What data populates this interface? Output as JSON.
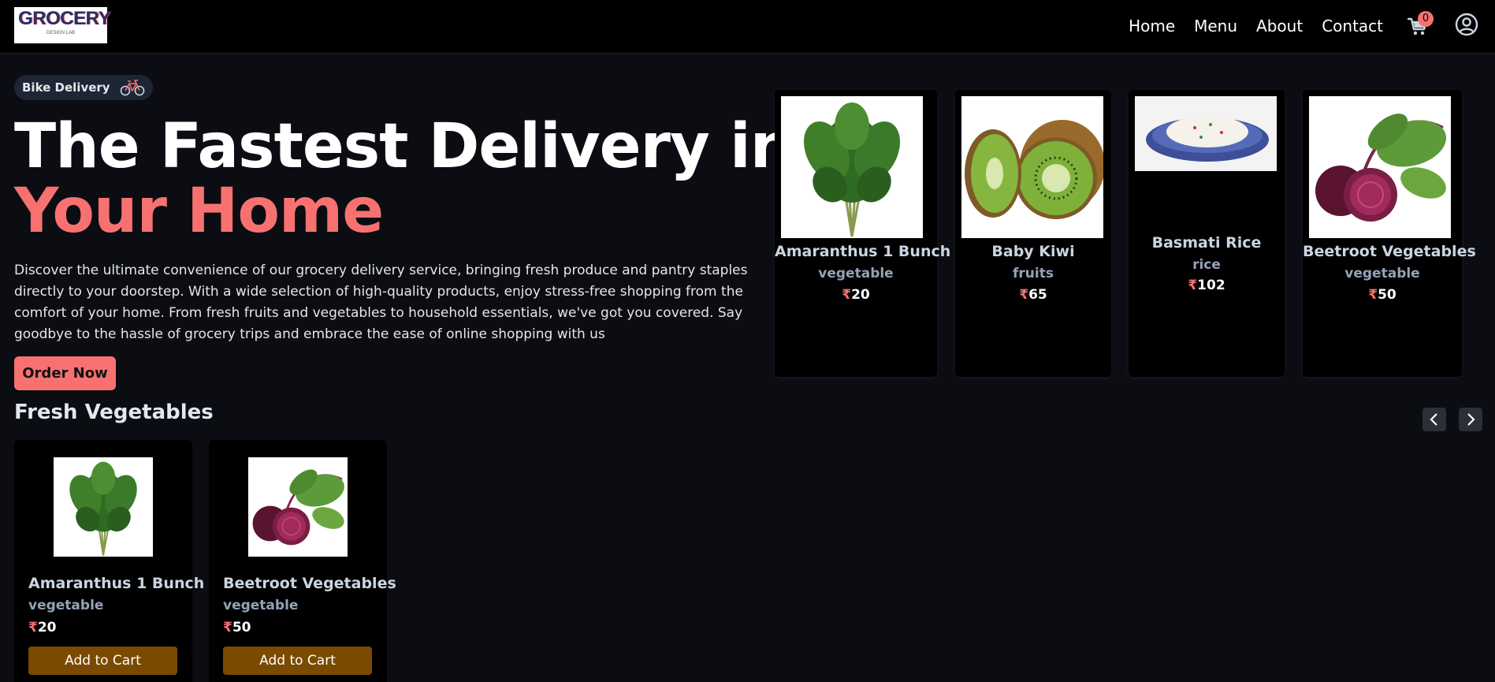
{
  "header": {
    "logo_text": "GROCERY",
    "logo_subtext": "DESIGN LAB",
    "nav": [
      "Home",
      "Menu",
      "About",
      "Contact"
    ],
    "cart_count": "0",
    "icons": {
      "cart": "cart-icon",
      "user": "user-icon"
    }
  },
  "hero": {
    "badge_label": "Bike Delivery",
    "badge_icon": "bicycle-icon",
    "title_line1": "The Fastest Delivery in",
    "title_line2": "Your Home",
    "description": "Discover the ultimate convenience of our grocery delivery service, bringing fresh produce and pantry staples directly to your doorstep. With a wide selection of high-quality products, enjoy stress-free shopping from the comfort of your home. From fresh fruits and vegetables to household essentials, we've got you covered. Say goodbye to the hassle of grocery trips and embrace the ease of online shopping with us",
    "cta": "Order Now",
    "cards": [
      {
        "name": "Amaranthus 1 Bunch",
        "category": "vegetable",
        "currency": "₹",
        "price": "20",
        "image": "amaranthus-image"
      },
      {
        "name": "Baby Kiwi",
        "category": "fruits",
        "currency": "₹",
        "price": "65",
        "image": "kiwi-image"
      },
      {
        "name": "Basmati Rice",
        "category": "rice",
        "currency": "₹",
        "price": "102",
        "image": "rice-image"
      },
      {
        "name": "Beetroot Vegetables",
        "category": "vegetable",
        "currency": "₹",
        "price": "50",
        "image": "beetroot-image"
      }
    ]
  },
  "section": {
    "title": "Fresh Vegetables",
    "prev_icon": "chevron-left-icon",
    "next_icon": "chevron-right-icon",
    "cards": [
      {
        "name": "Amaranthus 1 Bunch",
        "category": "vegetable",
        "currency": "₹",
        "price": "20",
        "button": "Add to Cart",
        "image": "amaranthus-image"
      },
      {
        "name": "Beetroot Vegetables",
        "category": "vegetable",
        "currency": "₹",
        "price": "50",
        "button": "Add to Cart",
        "image": "beetroot-image"
      }
    ]
  },
  "colors": {
    "accent": "#f87171",
    "background": "#0b0d12",
    "header": "#000000",
    "add_button": "#7a4a00",
    "muted_text": "#94a3b8"
  }
}
